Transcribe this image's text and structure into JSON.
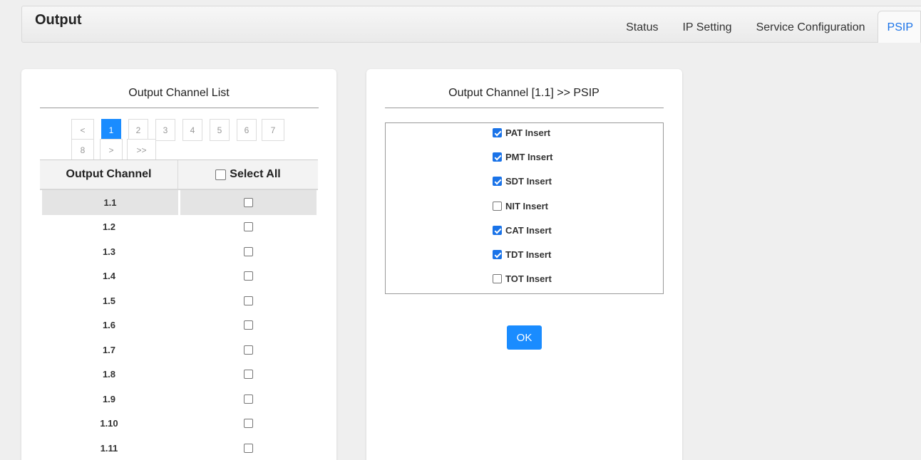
{
  "header": {
    "title": "Output"
  },
  "tabs": [
    {
      "label": "Status"
    },
    {
      "label": "IP Setting"
    },
    {
      "label": "Service Configuration"
    },
    {
      "label": "PSIP"
    }
  ],
  "channel_list": {
    "title": "Output Channel List",
    "pager": {
      "prev": "<",
      "pages": [
        "1",
        "2",
        "3",
        "4",
        "5",
        "6",
        "7",
        "8"
      ],
      "next": ">",
      "last": ">>",
      "current": "1"
    },
    "columns": {
      "channel": "Output Channel",
      "select_all": "Select All"
    },
    "rows": [
      "1.1",
      "1.2",
      "1.3",
      "1.4",
      "1.5",
      "1.6",
      "1.7",
      "1.8",
      "1.9",
      "1.10",
      "1.11"
    ]
  },
  "psip": {
    "title": "Output Channel  [1.1] >> PSIP",
    "options": [
      {
        "label": "PAT Insert",
        "checked": true
      },
      {
        "label": "PMT Insert",
        "checked": true
      },
      {
        "label": "SDT Insert",
        "checked": true
      },
      {
        "label": "NIT Insert",
        "checked": false
      },
      {
        "label": "CAT Insert",
        "checked": true
      },
      {
        "label": "TDT Insert",
        "checked": true
      },
      {
        "label": "TOT Insert",
        "checked": false
      }
    ],
    "ok_label": "OK"
  },
  "colors": {
    "accent": "#1a8cff",
    "checkbox": "#1a73e8",
    "background": "#efefef"
  }
}
